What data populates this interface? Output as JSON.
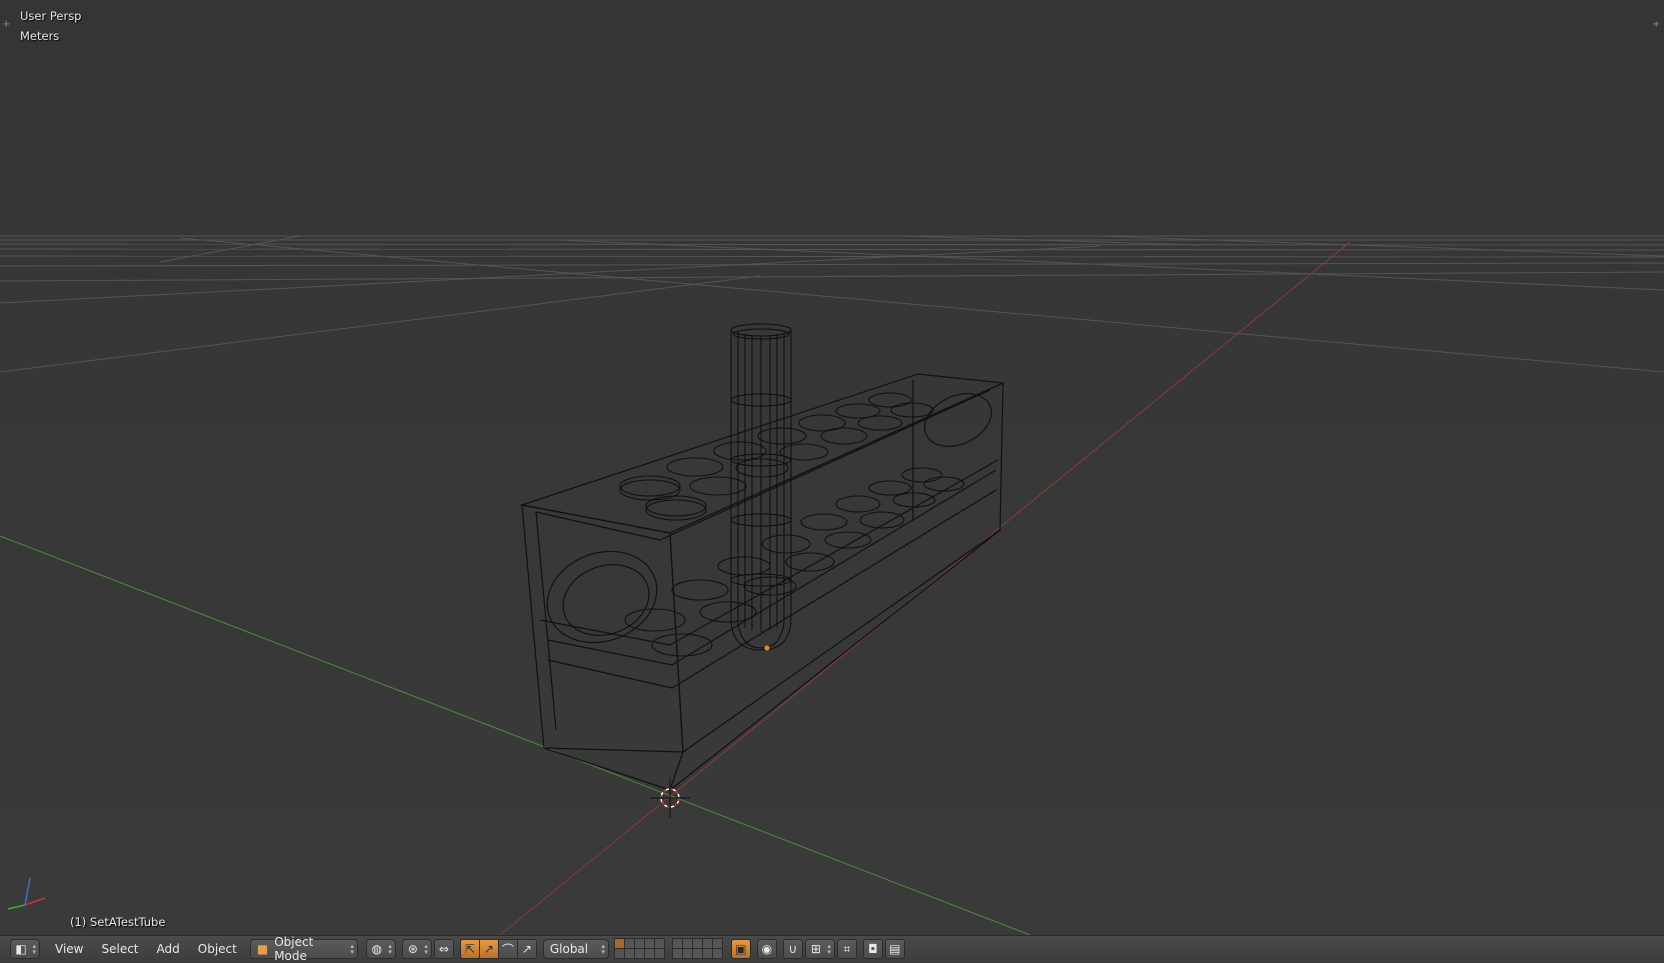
{
  "viewport": {
    "view_label": "User Persp",
    "units_label": "Meters",
    "object_info": "(1) SetATestTube"
  },
  "header": {
    "editor_type_icon": "3d-view-icon",
    "menus": [
      "View",
      "Select",
      "Add",
      "Object"
    ],
    "mode": "Object Mode",
    "transform_orientation": "Global"
  },
  "colors": {
    "viewport_bg": "#393939",
    "grid": "#555555",
    "x_axis": "#8a3a3a",
    "y_axis": "#4c8c3c",
    "wire": "#101010",
    "active_button": "#d08a3c"
  }
}
